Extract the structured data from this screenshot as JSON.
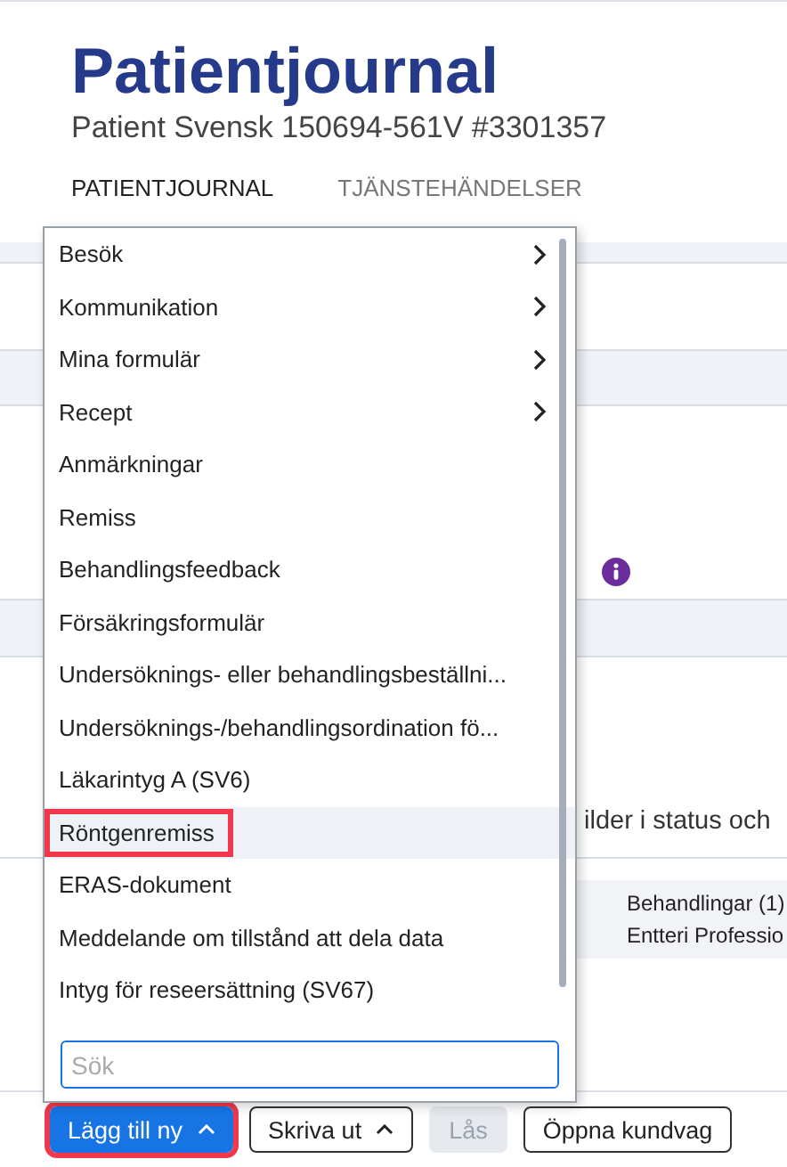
{
  "header": {
    "title": "Patientjournal",
    "subtitle": "Patient Svensk 150694-561V #3301357"
  },
  "tabs": [
    {
      "label": "PATIENTJOURNAL",
      "selected": true
    },
    {
      "label": "TJÄNSTEHÄNDELSER",
      "selected": false
    }
  ],
  "background": {
    "partial_text": "ilder i status och",
    "summary": [
      "Behandlingar (1)",
      "Entteri Professio"
    ]
  },
  "menu": {
    "items": [
      {
        "label": "Besök",
        "submenu": true,
        "selected": false,
        "annotated": false
      },
      {
        "label": "Kommunikation",
        "submenu": true,
        "selected": false,
        "annotated": false
      },
      {
        "label": "Mina formulär",
        "submenu": true,
        "selected": false,
        "annotated": false
      },
      {
        "label": "Recept",
        "submenu": true,
        "selected": false,
        "annotated": false
      },
      {
        "label": "Anmärkningar",
        "submenu": false,
        "selected": false,
        "annotated": false
      },
      {
        "label": "Remiss",
        "submenu": false,
        "selected": false,
        "annotated": false
      },
      {
        "label": "Behandlingsfeedback",
        "submenu": false,
        "selected": false,
        "annotated": false
      },
      {
        "label": "Försäkringsformulär",
        "submenu": false,
        "selected": false,
        "annotated": false
      },
      {
        "label": "Undersöknings- eller behandlingsbeställni...",
        "submenu": false,
        "selected": false,
        "annotated": false
      },
      {
        "label": "Undersöknings-/behandlingsordination fö...",
        "submenu": false,
        "selected": false,
        "annotated": false
      },
      {
        "label": "Läkarintyg A (SV6)",
        "submenu": false,
        "selected": false,
        "annotated": false
      },
      {
        "label": "Röntgenremiss",
        "submenu": false,
        "selected": true,
        "annotated": true
      },
      {
        "label": "ERAS-dokument",
        "submenu": false,
        "selected": false,
        "annotated": false
      },
      {
        "label": "Meddelande om tillstånd att dela data",
        "submenu": false,
        "selected": false,
        "annotated": false
      },
      {
        "label": "Intyg för reseersättning (SV67)",
        "submenu": false,
        "selected": false,
        "annotated": false
      }
    ],
    "search": {
      "placeholder": "Sök"
    }
  },
  "footer": [
    {
      "label": "Lägg till ny",
      "kind": "primary",
      "caret": true,
      "disabled": false,
      "annotated": true
    },
    {
      "label": "Skriva ut",
      "kind": "outline",
      "caret": true,
      "disabled": false,
      "annotated": false
    },
    {
      "label": "Lås",
      "kind": "outline",
      "caret": false,
      "disabled": true,
      "annotated": false
    },
    {
      "label": "Öppna kundvag",
      "kind": "outline",
      "caret": false,
      "disabled": false,
      "annotated": false
    }
  ]
}
